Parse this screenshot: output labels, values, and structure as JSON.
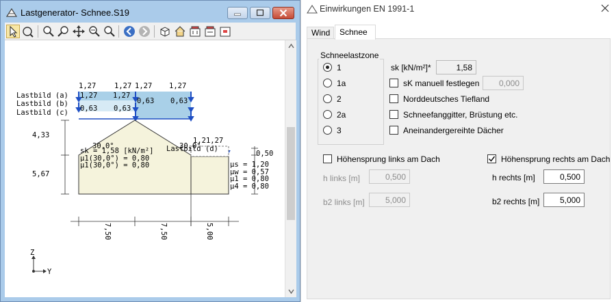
{
  "left_window": {
    "title": "Lastgenerator- Schnee.S19",
    "drawing": {
      "top_labels": [
        "1,27",
        "1,27",
        "1,27",
        "1,27"
      ],
      "load_case_labels": [
        "Lastbild (a)",
        "Lastbild (b)",
        "Lastbild (c)"
      ],
      "row_a_values": [
        "1,27",
        "1,27"
      ],
      "row_b_values": [
        "0,63",
        "0,63"
      ],
      "row_c_values": [
        "0,63",
        "0,63"
      ],
      "left_dims": [
        "4,33",
        "5,67"
      ],
      "left_building_text": [
        "sk = 1,58 [kN/m²]",
        "μ1(30,0°) = 0,80",
        "μ1(30,0°) = 0,80"
      ],
      "angle_label": "30,0°",
      "annex_labels": [
        "Lastbild (d)",
        "30,0°",
        "1,21,27",
        "0,50"
      ],
      "mu_values": [
        "μs = 1,20",
        "μw = 0,57",
        "μ1 = 0,80",
        "μ4 = 0,80"
      ],
      "bottom_dims": [
        "7,50",
        "7,50",
        "5,00"
      ],
      "axis_z": "Z",
      "axis_y": "Y"
    }
  },
  "dialog": {
    "title": "Einwirkungen EN 1991-1",
    "tabs": [
      "Wind",
      "Schnee"
    ],
    "active_tab": "Schnee",
    "zone_group_label": "Schneelastzone",
    "zones": [
      {
        "label": "1",
        "selected": true
      },
      {
        "label": "1a",
        "selected": false
      },
      {
        "label": "2",
        "selected": false
      },
      {
        "label": "2a",
        "selected": false
      },
      {
        "label": "3",
        "selected": false
      }
    ],
    "sk_label": "sk [kN/m²]*",
    "sk_value": "1,58",
    "sk_manual_label": "sK manuell festlegen",
    "sk_manual_checked": false,
    "sk_manual_value": "0,000",
    "options": [
      {
        "label": "Norddeutsches Tiefland",
        "checked": false
      },
      {
        "label": "Schneefanggitter, Brüstung etc.",
        "checked": false
      },
      {
        "label": "Aneinandergereihte Dächer",
        "checked": false
      }
    ],
    "step_left_label": "Höhensprung links am Dach",
    "step_left_checked": false,
    "step_right_label": "Höhensprung rechts am Dach",
    "step_right_checked": true,
    "h_links_label": "h links [m]",
    "h_links_value": "0,500",
    "b2_links_label": "b2 links [m]",
    "b2_links_value": "5,000",
    "h_rechts_label": "h rechts [m]",
    "h_rechts_value": "0,500",
    "b2_rechts_label": "b2 rechts [m]",
    "b2_rechts_value": "5,000"
  },
  "colors": {
    "load_fill": "#a9d0e8",
    "load_arrow": "#1f4fc4",
    "building_fill": "#f5f3dc",
    "title_bar": "#aacbea"
  }
}
